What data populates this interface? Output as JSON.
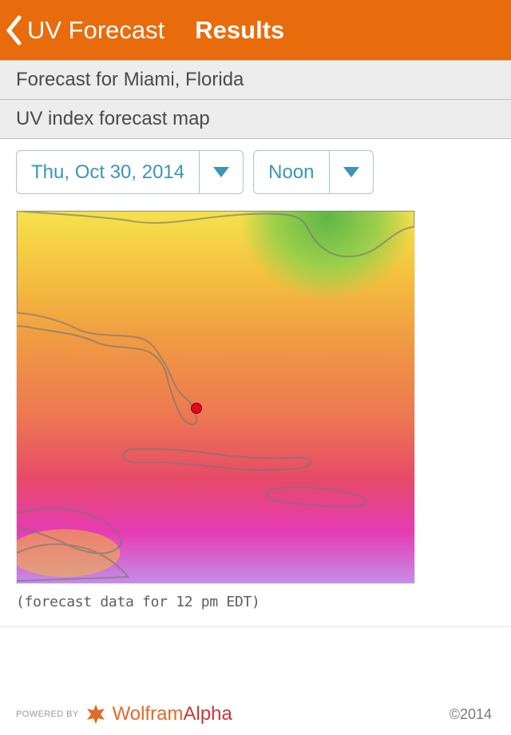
{
  "header": {
    "back_label": "UV Forecast",
    "title": "Results"
  },
  "section1": "Forecast for Miami, Florida",
  "section2": "UV index forecast map",
  "date_dd": {
    "label": "Thu, Oct 30, 2014"
  },
  "time_dd": {
    "label": "Noon"
  },
  "map": {
    "marker_location": "Miami"
  },
  "caption": "(forecast data for 12 pm EDT)",
  "footer": {
    "powered": "POWERED BY",
    "brand": "Wolfram",
    "brand_suffix": "Alpha",
    "copyright": "©2014"
  }
}
